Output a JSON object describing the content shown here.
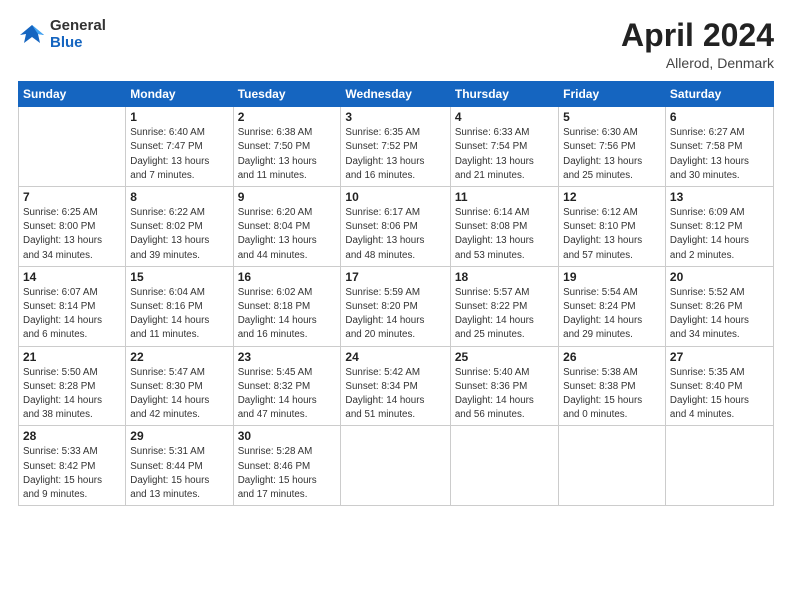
{
  "header": {
    "logo_general": "General",
    "logo_blue": "Blue",
    "month_year": "April 2024",
    "location": "Allerod, Denmark"
  },
  "days_of_week": [
    "Sunday",
    "Monday",
    "Tuesday",
    "Wednesday",
    "Thursday",
    "Friday",
    "Saturday"
  ],
  "weeks": [
    [
      {
        "day": "",
        "info": ""
      },
      {
        "day": "1",
        "info": "Sunrise: 6:40 AM\nSunset: 7:47 PM\nDaylight: 13 hours\nand 7 minutes."
      },
      {
        "day": "2",
        "info": "Sunrise: 6:38 AM\nSunset: 7:50 PM\nDaylight: 13 hours\nand 11 minutes."
      },
      {
        "day": "3",
        "info": "Sunrise: 6:35 AM\nSunset: 7:52 PM\nDaylight: 13 hours\nand 16 minutes."
      },
      {
        "day": "4",
        "info": "Sunrise: 6:33 AM\nSunset: 7:54 PM\nDaylight: 13 hours\nand 21 minutes."
      },
      {
        "day": "5",
        "info": "Sunrise: 6:30 AM\nSunset: 7:56 PM\nDaylight: 13 hours\nand 25 minutes."
      },
      {
        "day": "6",
        "info": "Sunrise: 6:27 AM\nSunset: 7:58 PM\nDaylight: 13 hours\nand 30 minutes."
      }
    ],
    [
      {
        "day": "7",
        "info": "Sunrise: 6:25 AM\nSunset: 8:00 PM\nDaylight: 13 hours\nand 34 minutes."
      },
      {
        "day": "8",
        "info": "Sunrise: 6:22 AM\nSunset: 8:02 PM\nDaylight: 13 hours\nand 39 minutes."
      },
      {
        "day": "9",
        "info": "Sunrise: 6:20 AM\nSunset: 8:04 PM\nDaylight: 13 hours\nand 44 minutes."
      },
      {
        "day": "10",
        "info": "Sunrise: 6:17 AM\nSunset: 8:06 PM\nDaylight: 13 hours\nand 48 minutes."
      },
      {
        "day": "11",
        "info": "Sunrise: 6:14 AM\nSunset: 8:08 PM\nDaylight: 13 hours\nand 53 minutes."
      },
      {
        "day": "12",
        "info": "Sunrise: 6:12 AM\nSunset: 8:10 PM\nDaylight: 13 hours\nand 57 minutes."
      },
      {
        "day": "13",
        "info": "Sunrise: 6:09 AM\nSunset: 8:12 PM\nDaylight: 14 hours\nand 2 minutes."
      }
    ],
    [
      {
        "day": "14",
        "info": "Sunrise: 6:07 AM\nSunset: 8:14 PM\nDaylight: 14 hours\nand 6 minutes."
      },
      {
        "day": "15",
        "info": "Sunrise: 6:04 AM\nSunset: 8:16 PM\nDaylight: 14 hours\nand 11 minutes."
      },
      {
        "day": "16",
        "info": "Sunrise: 6:02 AM\nSunset: 8:18 PM\nDaylight: 14 hours\nand 16 minutes."
      },
      {
        "day": "17",
        "info": "Sunrise: 5:59 AM\nSunset: 8:20 PM\nDaylight: 14 hours\nand 20 minutes."
      },
      {
        "day": "18",
        "info": "Sunrise: 5:57 AM\nSunset: 8:22 PM\nDaylight: 14 hours\nand 25 minutes."
      },
      {
        "day": "19",
        "info": "Sunrise: 5:54 AM\nSunset: 8:24 PM\nDaylight: 14 hours\nand 29 minutes."
      },
      {
        "day": "20",
        "info": "Sunrise: 5:52 AM\nSunset: 8:26 PM\nDaylight: 14 hours\nand 34 minutes."
      }
    ],
    [
      {
        "day": "21",
        "info": "Sunrise: 5:50 AM\nSunset: 8:28 PM\nDaylight: 14 hours\nand 38 minutes."
      },
      {
        "day": "22",
        "info": "Sunrise: 5:47 AM\nSunset: 8:30 PM\nDaylight: 14 hours\nand 42 minutes."
      },
      {
        "day": "23",
        "info": "Sunrise: 5:45 AM\nSunset: 8:32 PM\nDaylight: 14 hours\nand 47 minutes."
      },
      {
        "day": "24",
        "info": "Sunrise: 5:42 AM\nSunset: 8:34 PM\nDaylight: 14 hours\nand 51 minutes."
      },
      {
        "day": "25",
        "info": "Sunrise: 5:40 AM\nSunset: 8:36 PM\nDaylight: 14 hours\nand 56 minutes."
      },
      {
        "day": "26",
        "info": "Sunrise: 5:38 AM\nSunset: 8:38 PM\nDaylight: 15 hours\nand 0 minutes."
      },
      {
        "day": "27",
        "info": "Sunrise: 5:35 AM\nSunset: 8:40 PM\nDaylight: 15 hours\nand 4 minutes."
      }
    ],
    [
      {
        "day": "28",
        "info": "Sunrise: 5:33 AM\nSunset: 8:42 PM\nDaylight: 15 hours\nand 9 minutes."
      },
      {
        "day": "29",
        "info": "Sunrise: 5:31 AM\nSunset: 8:44 PM\nDaylight: 15 hours\nand 13 minutes."
      },
      {
        "day": "30",
        "info": "Sunrise: 5:28 AM\nSunset: 8:46 PM\nDaylight: 15 hours\nand 17 minutes."
      },
      {
        "day": "",
        "info": ""
      },
      {
        "day": "",
        "info": ""
      },
      {
        "day": "",
        "info": ""
      },
      {
        "day": "",
        "info": ""
      }
    ]
  ]
}
